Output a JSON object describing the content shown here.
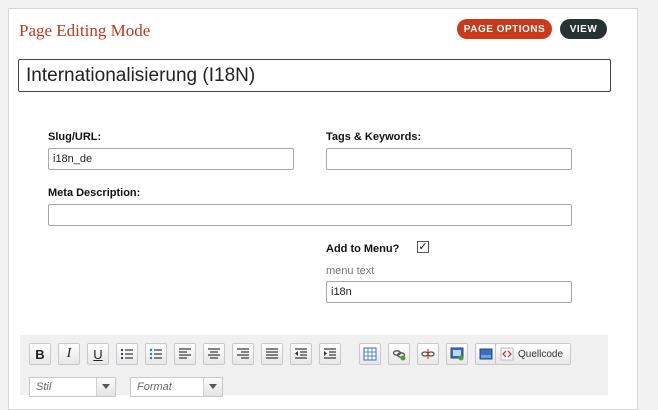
{
  "page": {
    "title": "Page Editing Mode",
    "page_options_label": "PAGE OPTIONS",
    "view_label": "VIEW"
  },
  "form": {
    "page_title_value": "Internationalisierung (I18N)",
    "slug_label": "Slug/URL:",
    "slug_value": "i18n_de",
    "tags_label": "Tags & Keywords:",
    "tags_value": "",
    "meta_label": "Meta Description:",
    "meta_value": "",
    "add_to_menu_label": "Add to Menu?",
    "add_to_menu_checked": true,
    "checkmark": "✓",
    "menu_text_label": "menu text",
    "menu_text_value": "i18n"
  },
  "editor": {
    "bold": "B",
    "italic": "I",
    "underline": "U",
    "source_label": "Quellcode",
    "style_placeholder": "Stil",
    "format_placeholder": "Format",
    "icons": [
      "bold-icon",
      "italic-icon",
      "underline-icon",
      "numbered-list-icon",
      "bulleted-list-icon",
      "align-left-icon",
      "align-center-icon",
      "align-right-icon",
      "justify-icon",
      "outdent-icon",
      "indent-icon",
      "table-icon",
      "link-icon",
      "unlink-icon",
      "image-icon",
      "flash-icon",
      "source-icon"
    ]
  }
}
